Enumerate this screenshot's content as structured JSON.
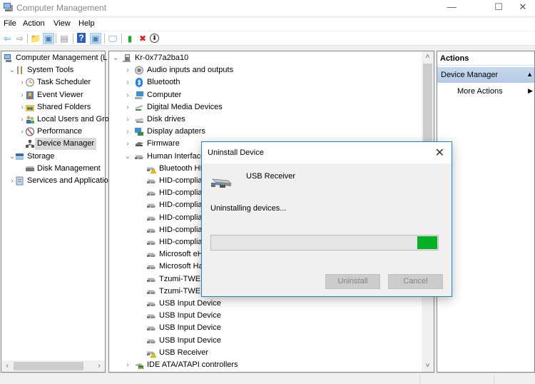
{
  "window": {
    "title": "Computer Management",
    "icon": "computer-management-icon",
    "controls": {
      "minimize": "—",
      "maximize": "☐",
      "close": "✕"
    }
  },
  "menu": [
    "File",
    "Action",
    "View",
    "Help"
  ],
  "toolbar": {
    "buttons": [
      {
        "name": "back",
        "icon": "back-arrow-icon",
        "glyph": "⇦",
        "color": "#3c8fe0"
      },
      {
        "name": "forward",
        "icon": "forward-arrow-icon",
        "glyph": "⇨",
        "color": "#8a8a8a"
      },
      {
        "name": "up-one-level",
        "icon": "folder-up-icon",
        "glyph": "📁",
        "color": "#d9a832"
      },
      {
        "name": "show-hide-console-tree",
        "icon": "console-tree-icon",
        "glyph": "▣",
        "color": "#4a7fb5"
      },
      {
        "name": "properties",
        "icon": "properties-icon",
        "glyph": "▤",
        "color": "#8a8a8a"
      },
      {
        "name": "help",
        "icon": "help-icon",
        "glyph": "?",
        "color": "#2b5fb9"
      },
      {
        "name": "show-hide-action-pane",
        "icon": "action-pane-icon",
        "glyph": "▣",
        "color": "#4a7fb5"
      },
      {
        "name": "scan-hardware",
        "icon": "monitor-scan-icon",
        "glyph": "🖵",
        "color": "#3d8fd6"
      },
      {
        "name": "update-driver",
        "icon": "update-driver-icon",
        "glyph": "▮",
        "color": "#2c9f3d"
      },
      {
        "name": "uninstall-device",
        "icon": "red-x-icon",
        "glyph": "✖",
        "color": "#e0201b"
      },
      {
        "name": "disable-device",
        "icon": "down-circle-icon",
        "glyph": "⬇",
        "color": "#222222"
      }
    ]
  },
  "left_tree": [
    {
      "label": "Computer Management (L",
      "level": 0,
      "expander": "",
      "icon": "computer-management-icon"
    },
    {
      "label": "System Tools",
      "level": 1,
      "expander": "⌄",
      "icon": "tools-icon"
    },
    {
      "label": "Task Scheduler",
      "level": 2,
      "expander": "›",
      "icon": "clock-icon"
    },
    {
      "label": "Event Viewer",
      "level": 2,
      "expander": "›",
      "icon": "event-viewer-icon"
    },
    {
      "label": "Shared Folders",
      "level": 2,
      "expander": "›",
      "icon": "shared-folder-icon"
    },
    {
      "label": "Local Users and Gro",
      "level": 2,
      "expander": "›",
      "icon": "users-icon"
    },
    {
      "label": "Performance",
      "level": 2,
      "expander": "›",
      "icon": "performance-icon"
    },
    {
      "label": "Device Manager",
      "level": 2,
      "expander": "",
      "icon": "device-manager-icon",
      "selected": true
    },
    {
      "label": "Storage",
      "level": 1,
      "expander": "⌄",
      "icon": "storage-icon"
    },
    {
      "label": "Disk Management",
      "level": 2,
      "expander": "",
      "icon": "disk-management-icon"
    },
    {
      "label": "Services and Applicatior",
      "level": 1,
      "expander": "›",
      "icon": "services-icon"
    }
  ],
  "device_tree": [
    {
      "label": "Kr-0x77a2ba10",
      "level": 0,
      "expander": "⌄",
      "icon": "computer-root-icon"
    },
    {
      "label": "Audio inputs and outputs",
      "level": 1,
      "expander": "›",
      "icon": "speaker-icon"
    },
    {
      "label": "Bluetooth",
      "level": 1,
      "expander": "›",
      "icon": "bluetooth-icon"
    },
    {
      "label": "Computer",
      "level": 1,
      "expander": "›",
      "icon": "computer-icon"
    },
    {
      "label": "Digital Media Devices",
      "level": 1,
      "expander": "›",
      "icon": "media-device-icon"
    },
    {
      "label": "Disk drives",
      "level": 1,
      "expander": "›",
      "icon": "disk-drive-icon"
    },
    {
      "label": "Display adapters",
      "level": 1,
      "expander": "›",
      "icon": "display-adapter-icon"
    },
    {
      "label": "Firmware",
      "level": 1,
      "expander": "›",
      "icon": "firmware-icon"
    },
    {
      "label": "Human Interface Devices",
      "level": 1,
      "expander": "⌄",
      "icon": "hid-icon"
    },
    {
      "label": "Bluetooth HID Device",
      "level": 2,
      "expander": "",
      "icon": "hid-warning-icon"
    },
    {
      "label": "HID-compliant device",
      "level": 2,
      "expander": "",
      "icon": "hid-icon"
    },
    {
      "label": "HID-compliant device",
      "level": 2,
      "expander": "",
      "icon": "hid-icon"
    },
    {
      "label": "HID-compliant device",
      "level": 2,
      "expander": "",
      "icon": "hid-icon"
    },
    {
      "label": "HID-compliant device",
      "level": 2,
      "expander": "",
      "icon": "hid-icon"
    },
    {
      "label": "HID-compliant device",
      "level": 2,
      "expander": "",
      "icon": "hid-icon"
    },
    {
      "label": "HID-compliant device",
      "level": 2,
      "expander": "",
      "icon": "hid-icon"
    },
    {
      "label": "Microsoft eHome",
      "level": 2,
      "expander": "",
      "icon": "hid-icon"
    },
    {
      "label": "Microsoft Hardware",
      "level": 2,
      "expander": "",
      "icon": "hid-icon"
    },
    {
      "label": "Tzumi-TWE A",
      "level": 2,
      "expander": "",
      "icon": "hid-icon"
    },
    {
      "label": "Tzumi-TWE H",
      "level": 2,
      "expander": "",
      "icon": "hid-icon"
    },
    {
      "label": "USB Input Device",
      "level": 2,
      "expander": "",
      "icon": "hid-icon"
    },
    {
      "label": "USB Input Device",
      "level": 2,
      "expander": "",
      "icon": "hid-icon"
    },
    {
      "label": "USB Input Device",
      "level": 2,
      "expander": "",
      "icon": "hid-icon"
    },
    {
      "label": "USB Input Device",
      "level": 2,
      "expander": "",
      "icon": "hid-icon"
    },
    {
      "label": "USB Receiver",
      "level": 2,
      "expander": "",
      "icon": "hid-warning-icon"
    },
    {
      "label": "IDE ATA/ATAPI controllers",
      "level": 1,
      "expander": "›",
      "icon": "ide-controller-icon"
    }
  ],
  "actions": {
    "header": "Actions",
    "section": "Device Manager",
    "section_caret": "▲",
    "items": [
      {
        "label": "More Actions",
        "arrow": "▶"
      }
    ]
  },
  "dialog": {
    "title": "Uninstall Device",
    "close_glyph": "✕",
    "device_name": "USB Receiver",
    "status": "Uninstalling devices...",
    "progress": {
      "mode": "marquee",
      "color": "#06b025"
    },
    "buttons": [
      {
        "label": "Uninstall",
        "enabled": false
      },
      {
        "label": "Cancel",
        "enabled": false
      }
    ]
  },
  "scroll": {
    "left_arrow": "‹",
    "right_arrow": "›",
    "up_arrow": "˄",
    "down_arrow": "˅"
  }
}
